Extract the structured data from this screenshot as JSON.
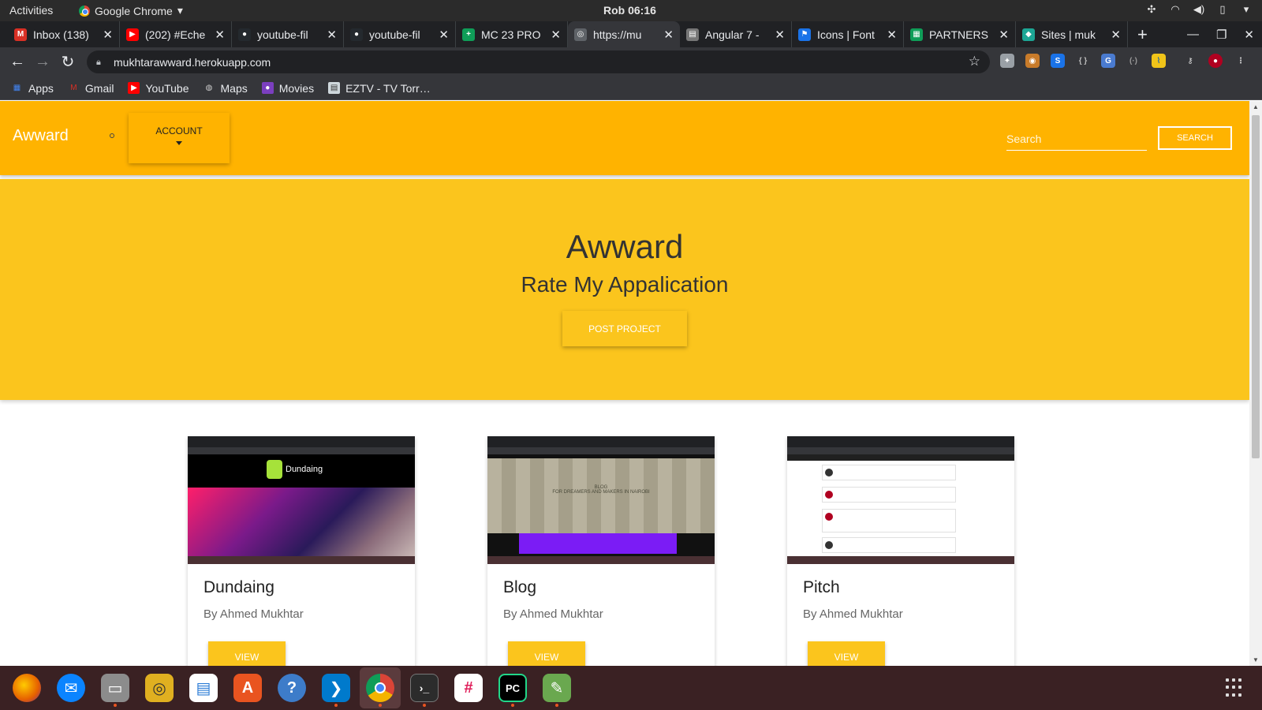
{
  "gnome": {
    "activities": "Activities",
    "app_name": "Google Chrome",
    "clock": "Rob 06:16"
  },
  "tabs": [
    {
      "title": "Inbox (138)",
      "icon": "gmail-icon",
      "color": "#d93025",
      "glyph": "M"
    },
    {
      "title": "(202) #Eche",
      "icon": "youtube-icon",
      "color": "#ff0000",
      "glyph": "▶"
    },
    {
      "title": "youtube-fil",
      "icon": "github-icon",
      "color": "#24292e",
      "glyph": "●"
    },
    {
      "title": "youtube-fil",
      "icon": "github-icon",
      "color": "#24292e",
      "glyph": "●"
    },
    {
      "title": "MC 23 PRO",
      "icon": "sheets-icon",
      "color": "#0f9d58",
      "glyph": "+"
    },
    {
      "title": "https://mu",
      "icon": "globe-icon",
      "color": "#5f6368",
      "glyph": "◎"
    },
    {
      "title": "Angular 7 -",
      "icon": "document-icon",
      "color": "#777777",
      "glyph": "▤"
    },
    {
      "title": "Icons | Font",
      "icon": "flag-icon",
      "color": "#1a73e8",
      "glyph": "⚑"
    },
    {
      "title": "PARTNERS",
      "icon": "sheets-icon",
      "color": "#0f9d58",
      "glyph": "▦"
    },
    {
      "title": "Sites | muk",
      "icon": "diamond-icon",
      "color": "#1ca695",
      "glyph": "◆"
    }
  ],
  "active_tab_index": 5,
  "omnibox": {
    "url": "mukhtarawward.herokuapp.com"
  },
  "bookmarks": [
    {
      "label": "Apps",
      "icon": "apps-grid-icon",
      "color": "#4285f4"
    },
    {
      "label": "Gmail",
      "icon": "gmail-icon",
      "color": "#d93025"
    },
    {
      "label": "YouTube",
      "icon": "youtube-icon",
      "color": "#ff0000"
    },
    {
      "label": "Maps",
      "icon": "globe-icon",
      "color": "#9aa0a6"
    },
    {
      "label": "Movies",
      "icon": "movie-icon",
      "color": "#7b3fbf"
    },
    {
      "label": "EZTV - TV Torr…",
      "icon": "document-icon",
      "color": "#cfd8dc"
    }
  ],
  "site": {
    "brand": "Awward",
    "account_label": "ACCOUNT",
    "search_placeholder": "Search",
    "search_button": "SEARCH",
    "accent_color": "#ffb300",
    "hero_color": "#fbc51d"
  },
  "hero": {
    "title": "Awward",
    "subtitle": "Rate My Appalication",
    "post_button": "POST PROJECT"
  },
  "projects": [
    {
      "title": "Dundaing",
      "author": "By Ahmed Mukhtar",
      "view_label": "VIEW",
      "thumb_brand": "Dundaing"
    },
    {
      "title": "Blog",
      "author": "By Ahmed Mukhtar",
      "view_label": "VIEW",
      "thumb_heading": "BLOG",
      "thumb_sub": "FOR DREAMERS AND MAKERS IN NAIROBI"
    },
    {
      "title": "Pitch",
      "author": "By Ahmed Mukhtar",
      "view_label": "VIEW"
    }
  ],
  "dock": [
    {
      "name": "firefox-icon",
      "color": "#e66000",
      "glyph": "◉",
      "running": false
    },
    {
      "name": "thunderbird-icon",
      "color": "#0a84ff",
      "glyph": "✉",
      "running": false
    },
    {
      "name": "files-icon",
      "color": "#8c8c8c",
      "glyph": "▭",
      "running": true
    },
    {
      "name": "rhythmbox-icon",
      "color": "#e0b020",
      "glyph": "◎",
      "running": false
    },
    {
      "name": "writer-icon",
      "color": "#2a7bd6",
      "glyph": "▤",
      "running": false
    },
    {
      "name": "software-center-icon",
      "color": "#e95420",
      "glyph": "A",
      "running": false
    },
    {
      "name": "help-icon",
      "color": "#3d7cc9",
      "glyph": "?",
      "running": false
    },
    {
      "name": "vscode-icon",
      "color": "#007acc",
      "glyph": "❯",
      "running": true
    },
    {
      "name": "chrome-icon",
      "color": "#db4437",
      "glyph": "◉",
      "running": true,
      "active": true
    },
    {
      "name": "terminal-icon",
      "color": "#2c2c2c",
      "glyph": "›_",
      "running": true
    },
    {
      "name": "slack-icon",
      "color": "#4a154b",
      "glyph": "#",
      "running": false
    },
    {
      "name": "pycharm-icon",
      "color": "#21d789",
      "glyph": "PC",
      "running": true
    },
    {
      "name": "image-viewer-icon",
      "color": "#6aa84f",
      "glyph": "✎",
      "running": true
    }
  ]
}
